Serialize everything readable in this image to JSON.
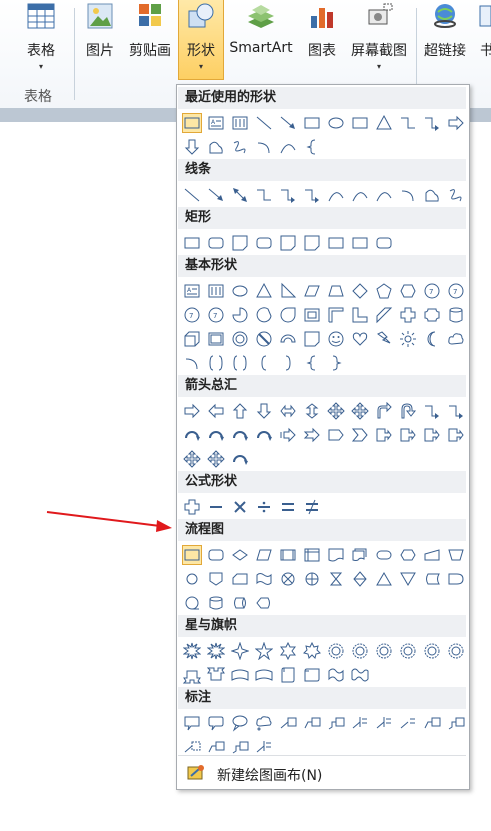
{
  "ribbon": {
    "buttons": [
      {
        "label": "表格",
        "dropdown": "▾",
        "icon": "table-icon"
      },
      {
        "label": "图片",
        "icon": "picture-icon"
      },
      {
        "label": "剪贴画",
        "icon": "clipart-icon"
      },
      {
        "label": "形状",
        "dropdown": "▾",
        "icon": "shapes-icon"
      },
      {
        "label": "SmartArt",
        "icon": "smartart-icon"
      },
      {
        "label": "图表",
        "icon": "chart-icon"
      },
      {
        "label": "屏幕截图",
        "dropdown": "▾",
        "icon": "screenshot-icon"
      },
      {
        "label": "超链接",
        "icon": "hyperlink-icon"
      },
      {
        "label": "书",
        "icon": "bookmark-icon"
      }
    ],
    "group_label": "表格",
    "colors": {
      "active_fill": "#fdcf63",
      "active_border": "#e2a838"
    }
  },
  "dropdown": {
    "sections": [
      {
        "title": "最近使用的形状"
      },
      {
        "title": "线条"
      },
      {
        "title": "矩形"
      },
      {
        "title": "基本形状"
      },
      {
        "title": "箭头总汇"
      },
      {
        "title": "公式形状"
      },
      {
        "title": "流程图"
      },
      {
        "title": "星与旗帜"
      },
      {
        "title": "标注"
      }
    ],
    "footer_label": "新建绘图画布(N)"
  },
  "annotation": {
    "arrow_color": "#e0191c"
  }
}
